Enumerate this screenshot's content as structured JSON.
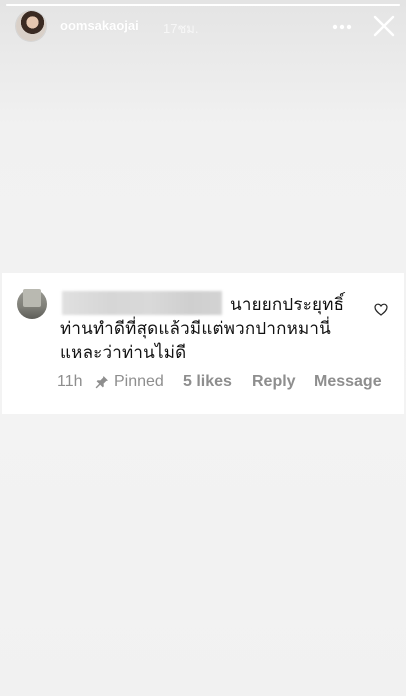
{
  "story": {
    "username": "oomsakaojai",
    "time": "17ชม.",
    "progress": 1.0
  },
  "header_icons": [
    "more-icon",
    "close-icon"
  ],
  "comment": {
    "lines": [
      "นายยกประยุทธิ์",
      "ท่านทำดีที่สุดแล้วมีแต่พวกปากหมานี่",
      "แหละว่าท่านไม่ดี"
    ],
    "time": "11h",
    "pinned": "Pinned",
    "likes": "5 likes",
    "reply": "Reply",
    "message": "Message"
  },
  "colors": {
    "background": "#f2f2f2",
    "card": "#ffffff",
    "meta": "#8e8e8e"
  }
}
